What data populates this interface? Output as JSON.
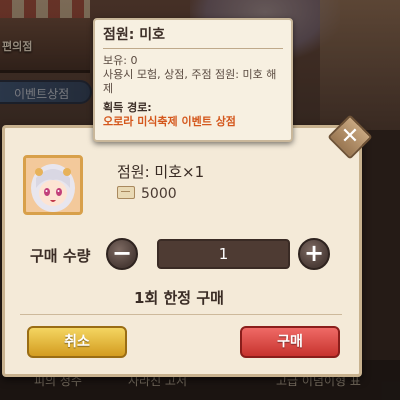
{
  "background": {
    "store_label": "편의점",
    "event_tab_label": "이벤트상점",
    "bottom_items": [
      "피의 정수",
      "사라진 고서",
      "고급 이념이형 표"
    ]
  },
  "tooltip": {
    "title": "점원: 미호",
    "owned": "보유:  0",
    "description": "사용시 모험, 상점, 주점 점원: 미호 해제",
    "source_label": "획득 경로:",
    "source_value": "오로라 미식축제 이벤트 상점"
  },
  "dialog": {
    "close_icon": "close-icon",
    "item_name": "점원: 미호×1",
    "price": "5000",
    "currency_icon": "coupon-icon",
    "quantity_label": "구매 수량",
    "quantity_value": "1",
    "minus_label": "−",
    "plus_label": "+",
    "limit_text": "1회 한정 구매",
    "cancel_label": "취소",
    "buy_label": "구매"
  },
  "colors": {
    "dialog_bg": "#f4ead8",
    "accent_orange": "#d4571c",
    "cancel_button": "#e3b53a",
    "buy_button": "#dc4a45"
  }
}
